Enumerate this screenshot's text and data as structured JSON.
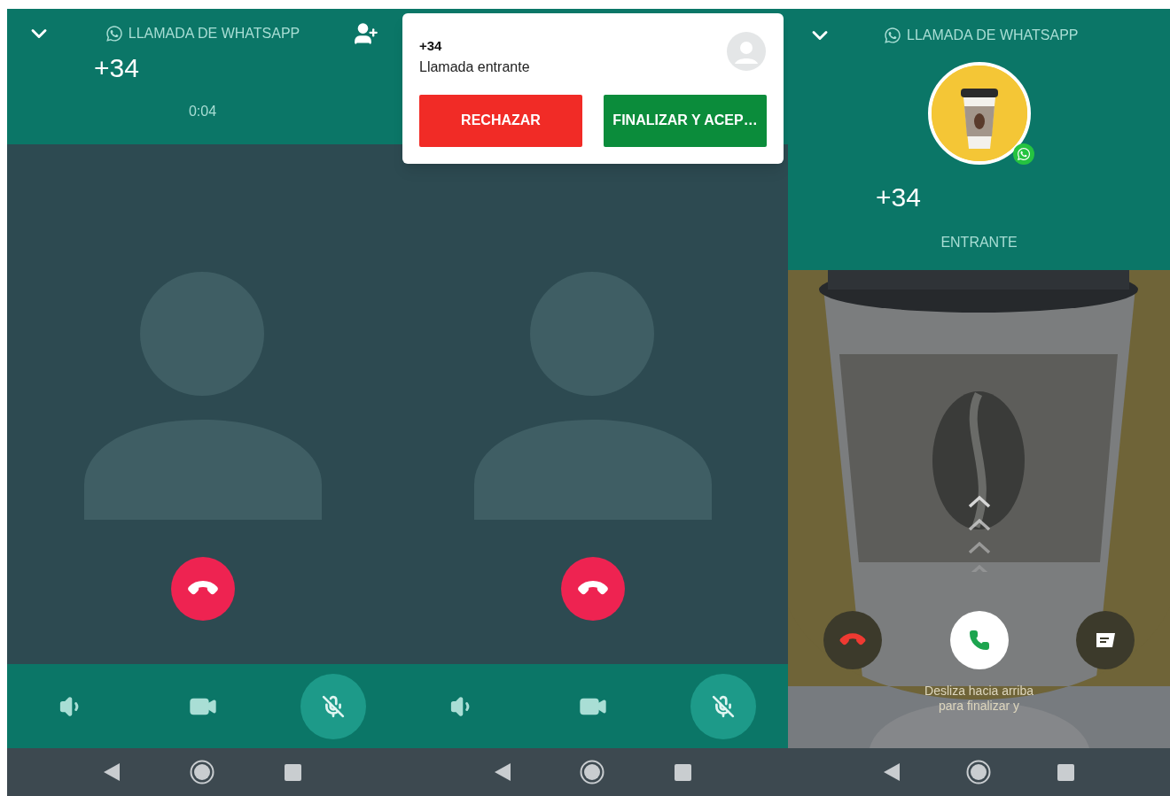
{
  "screens": [
    {
      "kind": "ongoing",
      "header": {
        "title": "LLAMADA DE WHATSAPP",
        "number": "+34",
        "status": "0:04"
      },
      "controls": [
        {
          "kind": "speaker",
          "selected": false
        },
        {
          "kind": "video",
          "selected": false
        },
        {
          "kind": "mute",
          "selected": true
        }
      ]
    },
    {
      "kind": "ongoing",
      "notification": {
        "number": "+34",
        "text": "Llamada entrante",
        "buttons": [
          {
            "kind": "reject",
            "label": "RECHAZAR"
          },
          {
            "kind": "accept",
            "label": "FINALIZAR Y ACEP…"
          }
        ]
      },
      "controls": [
        {
          "kind": "speaker",
          "selected": false
        },
        {
          "kind": "video",
          "selected": false
        },
        {
          "kind": "mute",
          "selected": true
        }
      ]
    },
    {
      "kind": "incoming",
      "header": {
        "title": "LLAMADA DE WHATSAPP",
        "number": "+34",
        "status": "ENTRANTE"
      },
      "hint": "Desliza hacia arriba para finalizar y"
    }
  ]
}
